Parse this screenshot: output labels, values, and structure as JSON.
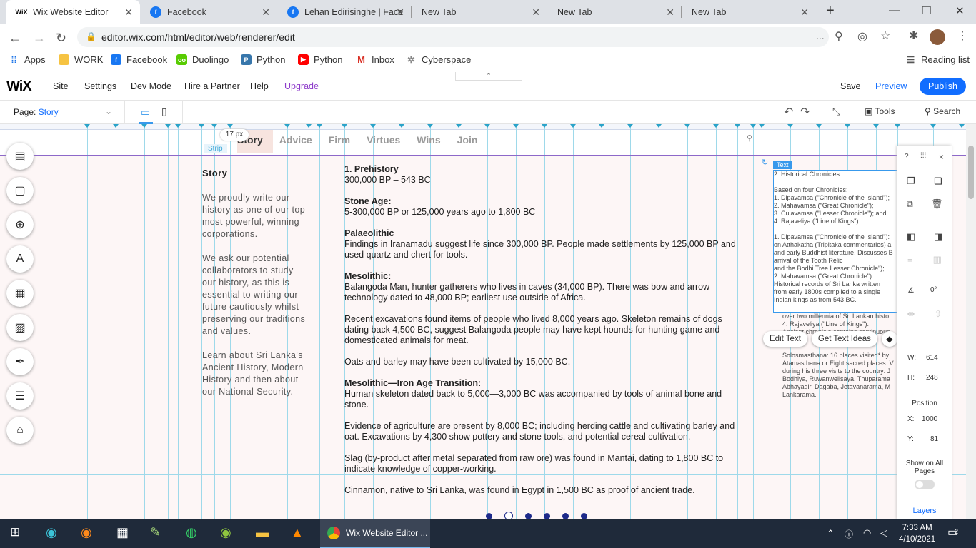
{
  "browser": {
    "tabs": [
      {
        "title": "Wix Website Editor",
        "icon": "wix-icon",
        "active": true
      },
      {
        "title": "Facebook",
        "icon": "facebook-icon"
      },
      {
        "title": "Lehan Edirisinghe | Face",
        "icon": "facebook-icon"
      },
      {
        "title": "New Tab",
        "icon": ""
      },
      {
        "title": "New Tab",
        "icon": ""
      },
      {
        "title": "New Tab",
        "icon": ""
      }
    ],
    "new_tab": "+",
    "url": "editor.wix.com/html/editor/web/renderer/edit",
    "url_more": "...",
    "bookmarks": [
      {
        "label": "Apps",
        "icon": "apps-grid-icon"
      },
      {
        "label": "WORK",
        "icon": "folder-icon"
      },
      {
        "label": "Facebook",
        "icon": "facebook-icon"
      },
      {
        "label": "Duolingo",
        "icon": "duolingo-icon"
      },
      {
        "label": "Python",
        "icon": "python-icon"
      },
      {
        "label": "Python",
        "icon": "youtube-icon"
      },
      {
        "label": "Inbox",
        "icon": "gmail-icon"
      },
      {
        "label": "Cyberspace",
        "icon": "gear-icon"
      }
    ],
    "reading_list": "Reading list"
  },
  "wix": {
    "logo": "WiX",
    "menu": [
      "Site",
      "Settings",
      "Dev Mode",
      "Hire a Partner",
      "Help",
      "Upgrade"
    ],
    "save": "Save",
    "preview": "Preview",
    "publish": "Publish",
    "page_label": "Page:",
    "page_name": "Story",
    "tools": "Tools",
    "search": "Search"
  },
  "canvas": {
    "site_menu": [
      "Story",
      "Advice",
      "Firm",
      "Virtues",
      "Wins",
      "Join"
    ],
    "px_badge": "17 px",
    "strip_label": "Strip",
    "left_title": "Story",
    "left_paragraphs": [
      "We proudly write our history as one of our top most powerful, winning corporations.",
      "We ask our potential collaborators to study our history, as this is essential to writing our future cautiously whilst preserving our traditions and values.",
      "Learn about Sri Lanka's Ancient History, Modern History and then about our National Security."
    ],
    "main_blocks": [
      {
        "heading": "1. Prehistory",
        "text": "300,000 BP – 543 BC"
      },
      {
        "heading": "Stone Age:",
        "text": "5-300,000 BP or 125,000 years ago to 1,800 BC"
      },
      {
        "heading": "Palaeolithic",
        "text": "Findings in Iranamadu suggest life since 300,000 BP. People made settlements by 125,000 BP and used quartz and chert for tools."
      },
      {
        "heading": "Mesolithic:",
        "text": "Balangoda Man, hunter gatherers who lives in caves (34,000 BP). There was bow and arrow technology dated to 48,000 BP; earliest use outside of Africa."
      },
      {
        "heading": "",
        "text": "Recent excavations found items of people who lived 8,000 years ago. Skeleton remains of dogs dating back 4,500 BC, suggest Balangoda people may have kept hounds for hunting game and domesticated animals for meat."
      },
      {
        "heading": "",
        "text": "Oats and barley may have been cultivated by 15,000 BC."
      },
      {
        "heading": "Mesolithic—Iron Age Transition:",
        "text": "Human skeleton dated back to 5,000—3,000 BC was accompanied by tools of animal bone and stone."
      },
      {
        "heading": "",
        "text": "Evidence of agriculture are present by 8,000 BC; including herding cattle and cultivating barley and oat. Excavations by 4,300 show pottery and stone tools, and potential cereal cultivation."
      },
      {
        "heading": "",
        "text": "Slag (by-product after metal separated from raw ore) was found in Mantai, dating to 1,800 BC to indicate knowledge of copper-working."
      },
      {
        "heading": "",
        "text": "Cinnamon, native to Sri Lanka, was found in Egypt in 1,500 BC as proof of ancient trade."
      }
    ],
    "text_box_label": "Text",
    "text_box_lines": [
      "2. Historical Chronicles",
      "",
      "Based on four Chronicles:",
      "1. Dipavamsa (\"Chronicle of the Island\");",
      "2. Mahavamsa (\"Great Chronicle\");",
      "3. Culavamsa (\"Lesser Chronicle\"); and",
      "4. Rajaveliya (\"Line of Kings\")",
      "",
      "1. Dipavamsa (\"Chronicle of the Island\"):",
      "on Atthakatha (Tripitaka commentaries) a",
      "and early Buddhist literature. Discusses B",
      "arrival of the Tooth Relic",
      "and the Bodhi Tree Lesser Chronicle\");",
      "2. Mahavamsa (\"Great Chronicle\"):",
      "Historical records of Sri Lanka written",
      "from early 1800s compiled to a single",
      "Indian kings as from 543 BC."
    ],
    "text_box_overflow": [
      "over two millennia of Sri Lankan histo",
      "4. Rajaveliya (\"Line of Kings\"):",
      "Ancient chronicle contains continuous",
      "",
      "",
      "Solosmasthana: 16 places visited* by",
      "Atamasthana or Eight sacred places: V",
      "during his three visits to the country: J",
      "Bodhiya, Ruwanwelisaya, Thuparama",
      "Abhayagiri Dagaba, Jetavanarama, M",
      "Lankarama."
    ],
    "edit_text": "Edit Text",
    "get_text_ideas": "Get Text Ideas",
    "slider_dots": 6
  },
  "props_panel": {
    "help": "?",
    "close": "×",
    "angle": "0°",
    "w_label": "W:",
    "w_value": "614",
    "h_label": "H:",
    "h_value": "248",
    "position": "Position",
    "x_label": "X:",
    "x_value": "1000",
    "y_label": "Y:",
    "y_value": "81",
    "show_all": "Show on All Pages",
    "layers": "Layers"
  },
  "taskbar": {
    "chrome_title": "Wix Website Editor ...",
    "time": "7:33 AM",
    "date": "4/10/2021",
    "notif": "2"
  }
}
